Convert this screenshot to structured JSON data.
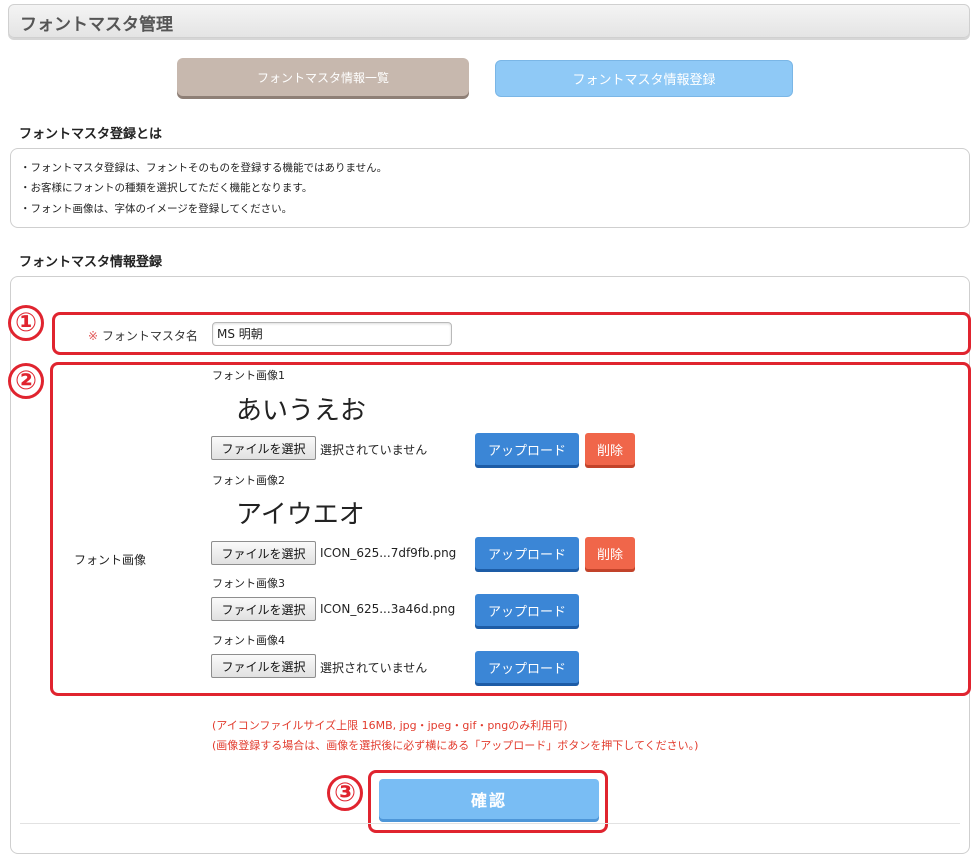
{
  "page_title": "フォントマスタ管理",
  "tabs": {
    "list_label": "フォントマスタ情報一覧",
    "register_label": "フォントマスタ情報登録"
  },
  "about": {
    "heading": "フォントマスタ登録とは",
    "lines": [
      "・フォントマスタ登録は、フォントそのものを登録する機能ではありません。",
      "・お客様にフォントの種類を選択してただく機能となります。",
      "・フォント画像は、字体のイメージを登録してください。"
    ]
  },
  "form": {
    "heading": "フォントマスタ情報登録",
    "name_field": {
      "required_mark": "※",
      "label": "フォントマスタ名",
      "value": "MS 明朝"
    },
    "image_section_label": "フォント画像",
    "images": [
      {
        "label": "フォント画像1",
        "preview": "あいうえお",
        "file_button": "ファイルを選択",
        "file_name": "選択されていません",
        "upload": "アップロード",
        "delete": "削除"
      },
      {
        "label": "フォント画像2",
        "preview": "アイウエオ",
        "file_button": "ファイルを選択",
        "file_name": "ICON_625...7df9fb.png",
        "upload": "アップロード",
        "delete": "削除"
      },
      {
        "label": "フォント画像3",
        "file_button": "ファイルを選択",
        "file_name": "ICON_625...3a46d.png",
        "upload": "アップロード"
      },
      {
        "label": "フォント画像4",
        "file_button": "ファイルを選択",
        "file_name": "選択されていません",
        "upload": "アップロード"
      }
    ],
    "notes": [
      "(アイコンファイルサイズ上限 16MB, jpg・jpeg・gif・pngのみ利用可)",
      "(画像登録する場合は、画像を選択後に必ず横にある「アップロード」ボタンを押下してください。)"
    ],
    "confirm_label": "確認"
  },
  "markers": [
    "①",
    "②",
    "③"
  ],
  "colors": {
    "annotation_red": "#e0242f",
    "upload_blue": "#3b86d6",
    "delete_orange": "#f0664a",
    "confirm_blue": "#79bdf4",
    "tab_brown": "#c7b8ae",
    "tab_blue": "#8fc9f6",
    "note_red": "#e23b2d"
  }
}
